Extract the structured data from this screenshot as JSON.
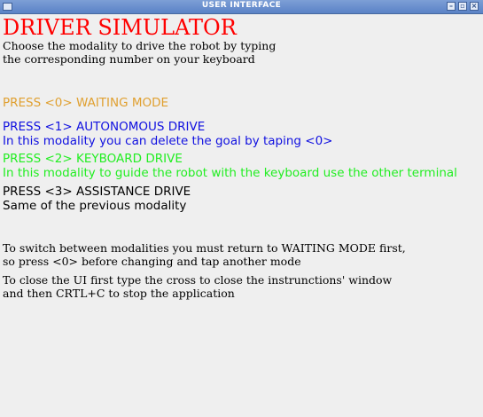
{
  "window": {
    "title": "USER INTERFACE"
  },
  "heading": "DRIVER SIMULATOR",
  "intro": [
    "Choose the modality to drive the robot by typing",
    "the corresponding number on your keyboard"
  ],
  "modes": {
    "waiting": {
      "label": "PRESS <0> WAITING MODE",
      "color": "#e0a030"
    },
    "autonomous": {
      "label": "PRESS <1> AUTONOMOUS DRIVE",
      "description": "In this modality you can delete the goal by taping <0>",
      "color": "#1010e0"
    },
    "keyboard": {
      "label": "PRESS <2> KEYBOARD DRIVE",
      "description": "In this modality to guide the robot with the keyboard use the other terminal",
      "color": "#22ee22"
    },
    "assistance": {
      "label": "PRESS <3> ASSISTANCE DRIVE",
      "description": "Same of the previous modality",
      "color": "#000000"
    }
  },
  "instructions": {
    "switch": [
      "To switch between modalities you must return to WAITING MODE first,",
      "so press <0> before changing and tap another mode"
    ],
    "close": [
      "To close the UI first type the cross to close the instrunctions' window",
      "and then CRTL+C to stop the application"
    ]
  }
}
